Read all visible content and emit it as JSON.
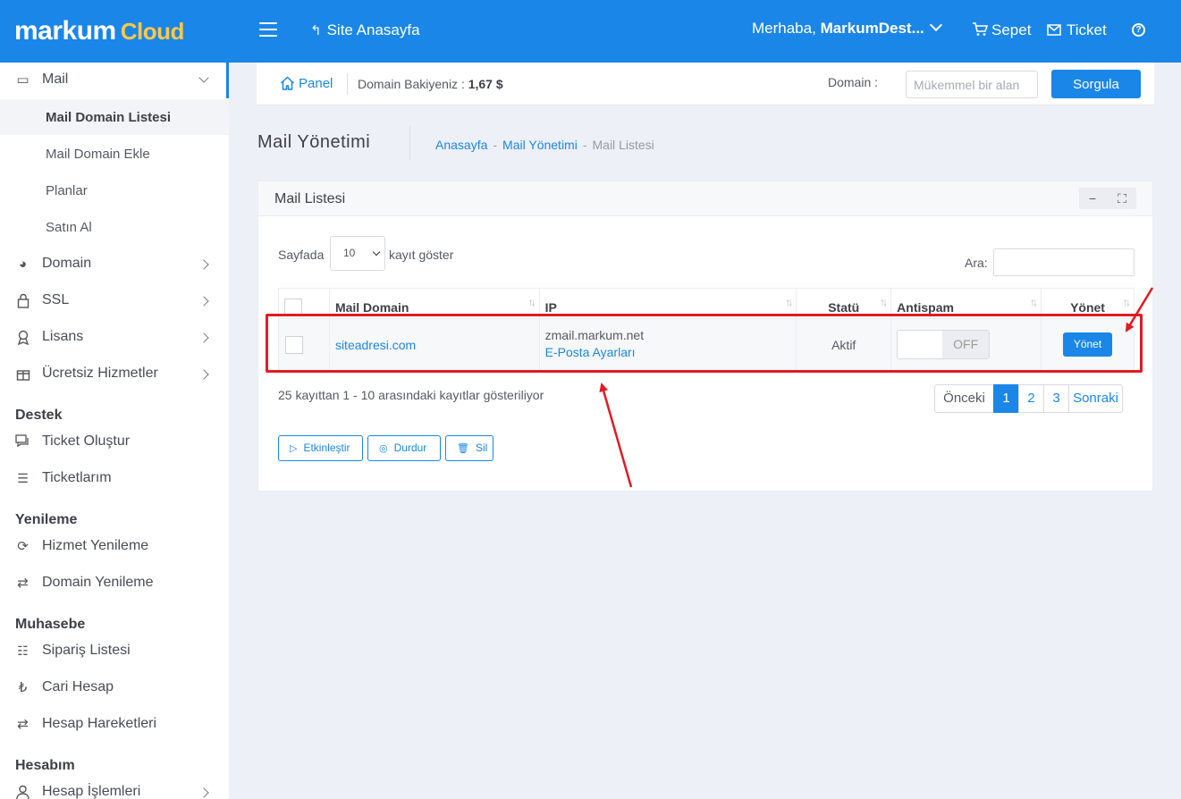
{
  "header": {
    "logo_main": "markum",
    "logo_sub": "Cloud",
    "site_link": "Site Anasayfa",
    "greeting_prefix": "Merhaba,",
    "greeting_user": "MarkumDest...",
    "cart_label": "Sepet",
    "ticket_label": "Ticket",
    "help_icon": "question-circle-icon",
    "accent_color": "#1a86e8",
    "logo_accent_color": "#ffc845"
  },
  "sidebar": {
    "mail": {
      "label": "Mail",
      "icon": "inbox-icon"
    },
    "mail_sub": [
      "Mail Domain Listesi",
      "Mail Domain Ekle",
      "Planlar",
      "Satın Al"
    ],
    "items": [
      {
        "label": "Domain",
        "icon": "globe-icon"
      },
      {
        "label": "SSL",
        "icon": "lock-icon"
      },
      {
        "label": "Lisans",
        "icon": "award-icon"
      },
      {
        "label": "Ücretsiz Hizmetler",
        "icon": "gift-icon"
      }
    ],
    "sections": [
      {
        "heading": "Destek",
        "items": [
          {
            "label": "Ticket Oluştur",
            "icon": "chat-icon"
          },
          {
            "label": "Ticketlarım",
            "icon": "list-icon"
          }
        ]
      },
      {
        "heading": "Yenileme",
        "items": [
          {
            "label": "Hizmet Yenileme",
            "icon": "refresh-icon"
          },
          {
            "label": "Domain Yenileme",
            "icon": "renew-icon"
          }
        ]
      },
      {
        "heading": "Muhasebe",
        "items": [
          {
            "label": "Sipariş Listesi",
            "icon": "checklist-icon"
          },
          {
            "label": "Cari Hesap",
            "icon": "lira-icon"
          },
          {
            "label": "Hesap Hareketleri",
            "icon": "transfer-icon"
          }
        ]
      },
      {
        "heading": "Hesabım",
        "items": [
          {
            "label": "Hesap İşlemleri",
            "icon": "user-icon"
          }
        ]
      }
    ]
  },
  "subbar": {
    "panel_label": "Panel",
    "balance_label": "Domain Bakiyeniz :",
    "balance_value": "1,67 $",
    "domain_label": "Domain :",
    "domain_placeholder": "Mükemmel bir alan",
    "search_button": "Sorgula"
  },
  "page": {
    "title": "Mail Yönetimi",
    "breadcrumb": [
      "Anasayfa",
      "Mail Yönetimi",
      "Mail Listesi"
    ]
  },
  "card": {
    "title": "Mail Listesi",
    "length_prefix": "Sayfada",
    "length_value": "10",
    "length_suffix": "kayıt göster",
    "search_label": "Ara:",
    "columns": [
      "Mail Domain",
      "IP",
      "Statü",
      "Antispam",
      "Yönet"
    ],
    "rows": [
      {
        "domain": "siteadresi.com",
        "ip": "zmail.markum.net",
        "ip_link": "E-Posta Ayarları",
        "status": "Aktif",
        "antispam": "OFF",
        "action": "Yönet"
      }
    ],
    "info": "25 kayıttan 1 - 10 arasındaki kayıtlar gösteriliyor",
    "pagination": {
      "prev": "Önceki",
      "pages": [
        "1",
        "2",
        "3"
      ],
      "active": "1",
      "next": "Sonraki"
    },
    "actions": [
      "Etkinleştir",
      "Durdur",
      "Sil"
    ]
  },
  "annotation_color": "#e11b22"
}
